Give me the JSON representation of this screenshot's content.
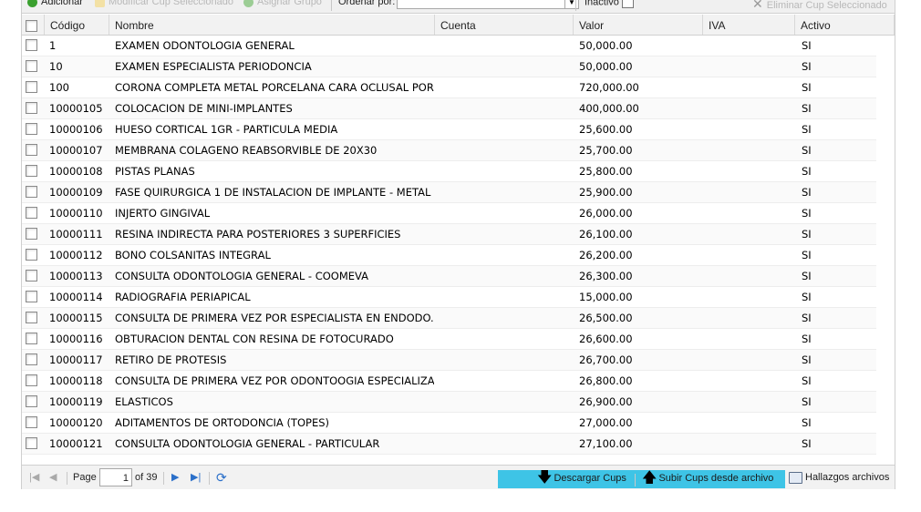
{
  "toolbar": {
    "add_label": "Adicionar",
    "modify_label": "Modificar Cup Seleccionado",
    "assign_label": "Asignar Grupo",
    "order_label": "Ordenar por:",
    "order_value": "",
    "inactive_label": "Inactivo",
    "delete_label": "Eliminar Cup Seleccionado"
  },
  "grid": {
    "columns": {
      "code": "Código",
      "name": "Nombre",
      "account": "Cuenta",
      "value": "Valor",
      "iva": "IVA",
      "active": "Activo"
    },
    "rows": [
      {
        "code": "1",
        "name": "EXAMEN ODONTOLOGIA GENERAL",
        "account": "",
        "value": "50,000.00",
        "iva": "",
        "active": "SI"
      },
      {
        "code": "10",
        "name": "EXAMEN ESPECIALISTA PERIODONCIA",
        "account": "",
        "value": "50,000.00",
        "iva": "",
        "active": "SI"
      },
      {
        "code": "100",
        "name": "CORONA COMPLETA METAL PORCELANA CARA OCLUSAL PORC...",
        "account": "",
        "value": "720,000.00",
        "iva": "",
        "active": "SI"
      },
      {
        "code": "10000105",
        "name": "COLOCACION DE MINI-IMPLANTES",
        "account": "",
        "value": "400,000.00",
        "iva": "",
        "active": "SI"
      },
      {
        "code": "10000106",
        "name": "HUESO CORTICAL 1GR - PARTICULA MEDIA",
        "account": "",
        "value": "25,600.00",
        "iva": "",
        "active": "SI"
      },
      {
        "code": "10000107",
        "name": "MEMBRANA COLAGENO REABSORVIBLE DE 20X30",
        "account": "",
        "value": "25,700.00",
        "iva": "",
        "active": "SI"
      },
      {
        "code": "10000108",
        "name": "PISTAS PLANAS",
        "account": "",
        "value": "25,800.00",
        "iva": "",
        "active": "SI"
      },
      {
        "code": "10000109",
        "name": "FASE QUIRURGICA 1 DE INSTALACION DE IMPLANTE - METAL ...",
        "account": "",
        "value": "25,900.00",
        "iva": "",
        "active": "SI"
      },
      {
        "code": "10000110",
        "name": "INJERTO GINGIVAL",
        "account": "",
        "value": "26,000.00",
        "iva": "",
        "active": "SI"
      },
      {
        "code": "10000111",
        "name": "RESINA INDIRECTA PARA POSTERIORES 3 SUPERFICIES",
        "account": "",
        "value": "26,100.00",
        "iva": "",
        "active": "SI"
      },
      {
        "code": "10000112",
        "name": "BONO COLSANITAS INTEGRAL",
        "account": "",
        "value": "26,200.00",
        "iva": "",
        "active": "SI"
      },
      {
        "code": "10000113",
        "name": "CONSULTA ODONTOLOGIA GENERAL - COOMEVA",
        "account": "",
        "value": "26,300.00",
        "iva": "",
        "active": "SI"
      },
      {
        "code": "10000114",
        "name": "RADIOGRAFIA PERIAPICAL",
        "account": "",
        "value": "15,000.00",
        "iva": "",
        "active": "SI"
      },
      {
        "code": "10000115",
        "name": "CONSULTA DE PRIMERA VEZ POR ESPECIALISTA EN ENDODO...",
        "account": "",
        "value": "26,500.00",
        "iva": "",
        "active": "SI"
      },
      {
        "code": "10000116",
        "name": "OBTURACION DENTAL CON RESINA DE FOTOCURADO",
        "account": "",
        "value": "26,600.00",
        "iva": "",
        "active": "SI"
      },
      {
        "code": "10000117",
        "name": "RETIRO DE PROTESIS",
        "account": "",
        "value": "26,700.00",
        "iva": "",
        "active": "SI"
      },
      {
        "code": "10000118",
        "name": "CONSULTA DE PRIMERA VEZ POR ODONTOOGIA ESPECIALIZA...",
        "account": "",
        "value": "26,800.00",
        "iva": "",
        "active": "SI"
      },
      {
        "code": "10000119",
        "name": "ELASTICOS",
        "account": "",
        "value": "26,900.00",
        "iva": "",
        "active": "SI"
      },
      {
        "code": "10000120",
        "name": "ADITAMENTOS DE ORTODONCIA (TOPES)",
        "account": "",
        "value": "27,000.00",
        "iva": "",
        "active": "SI"
      },
      {
        "code": "10000121",
        "name": "CONSULTA ODONTOLOGIA GENERAL - PARTICULAR",
        "account": "",
        "value": "27,100.00",
        "iva": "",
        "active": "SI"
      }
    ]
  },
  "pager": {
    "page_label": "Page",
    "page_value": "1",
    "of_label": "of 39",
    "download_label": "Descargar Cups",
    "upload_label": "Subir Cups desde archivo",
    "findings_label": "Hallazgos archivos"
  },
  "colors": {
    "accent_bar": "#3ec4e6",
    "add_icon": "#3aa02f",
    "pager_icon_active": "#2a6fc9"
  },
  "icons": {
    "add": "plus-circle-icon",
    "modify": "pencil-icon",
    "assign": "plus-circle-icon",
    "delete": "x-icon",
    "first": "first-page-icon",
    "prev": "prev-page-icon",
    "next": "next-page-icon",
    "last": "last-page-icon",
    "refresh": "refresh-icon",
    "download": "arrow-down-icon",
    "upload": "arrow-up-icon",
    "findings": "printer-icon"
  }
}
